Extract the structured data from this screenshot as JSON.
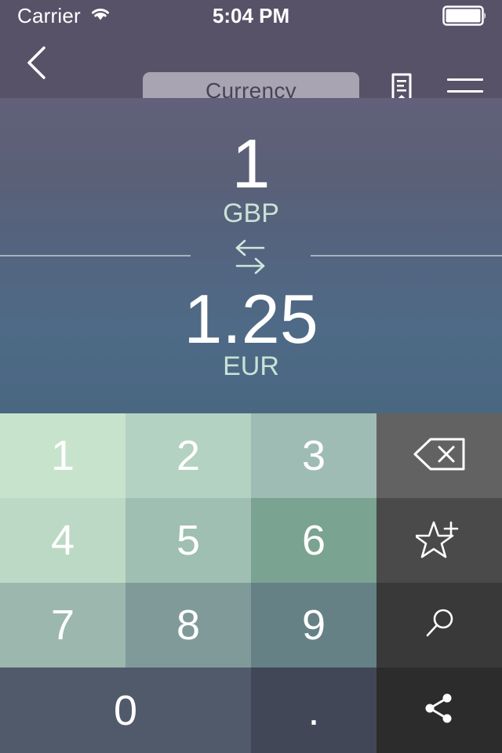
{
  "status_bar": {
    "carrier": "Carrier",
    "wifi_icon": "wifi-icon",
    "time": "5:04 PM",
    "battery_icon": "battery-full-icon"
  },
  "nav_bar": {
    "back_icon": "chevron-left-icon",
    "title": "Currency",
    "bookmark_icon": "bookmark-lines-icon",
    "menu_icon": "hamburger-menu-icon"
  },
  "display": {
    "from_amount": "1",
    "from_code": "GBP",
    "swap_icon": "swap-arrows-icon",
    "to_amount": "1.25",
    "to_code": "EUR"
  },
  "keypad": {
    "keys": [
      {
        "label": "1",
        "name": "key-1",
        "color": "#c8e3cb"
      },
      {
        "label": "2",
        "name": "key-2",
        "color": "#b4d2c2"
      },
      {
        "label": "3",
        "name": "key-3",
        "color": "#9ebcb4"
      },
      {
        "label": "4",
        "name": "key-4",
        "color": "#bcd9c5"
      },
      {
        "label": "5",
        "name": "key-5",
        "color": "#9ebfb2"
      },
      {
        "label": "6",
        "name": "key-6",
        "color": "#7aa391"
      },
      {
        "label": "7",
        "name": "key-7",
        "color": "#9cb7ae"
      },
      {
        "label": "8",
        "name": "key-8",
        "color": "#7f9a99"
      },
      {
        "label": "9",
        "name": "key-9",
        "color": "#658186"
      },
      {
        "label": "0",
        "name": "key-0",
        "color": "#515a6b"
      },
      {
        "label": ".",
        "name": "key-decimal",
        "color": "#414757"
      }
    ],
    "actions": [
      {
        "icon": "backspace-icon",
        "name": "backspace-key",
        "color": "#626262"
      },
      {
        "icon": "star-plus-icon",
        "name": "add-favorite-key",
        "color": "#4a4a4a"
      },
      {
        "icon": "search-icon",
        "name": "search-key",
        "color": "#393939"
      },
      {
        "icon": "share-icon",
        "name": "share-key",
        "color": "#2c2c2c"
      }
    ]
  },
  "colors": {
    "chrome": "#585268",
    "pill": "#a8a4b1",
    "accent_mint": "#c9e2d6"
  }
}
